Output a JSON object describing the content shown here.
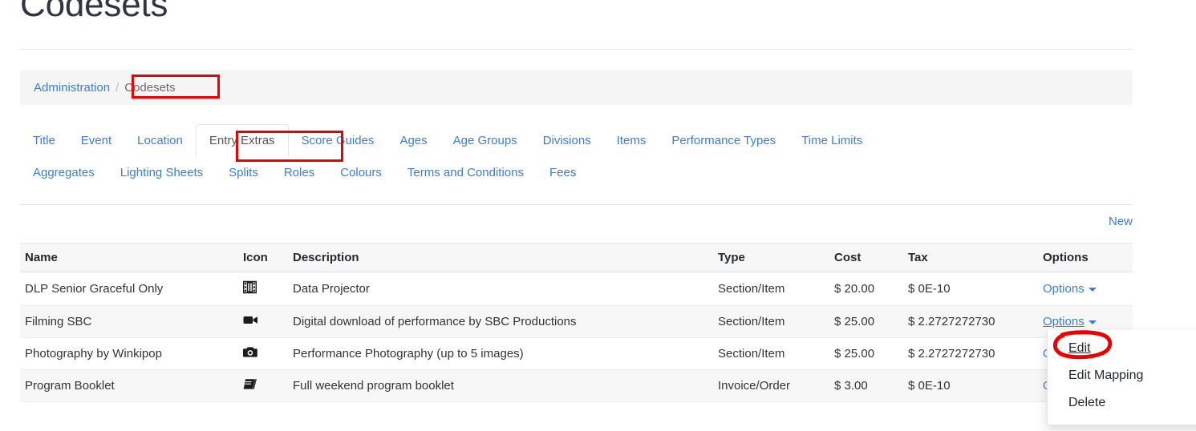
{
  "page": {
    "title": "Codesets"
  },
  "breadcrumb": {
    "parent": "Administration",
    "separator": "/",
    "current": "Codesets"
  },
  "tabs": {
    "row1": [
      {
        "label": "Title",
        "active": false
      },
      {
        "label": "Event",
        "active": false
      },
      {
        "label": "Location",
        "active": false
      },
      {
        "label": "Entry Extras",
        "active": true
      },
      {
        "label": "Score Guides",
        "active": false
      },
      {
        "label": "Ages",
        "active": false
      },
      {
        "label": "Age Groups",
        "active": false
      },
      {
        "label": "Divisions",
        "active": false
      },
      {
        "label": "Items",
        "active": false
      },
      {
        "label": "Performance Types",
        "active": false
      },
      {
        "label": "Time Limits",
        "active": false
      }
    ],
    "row2": [
      {
        "label": "Aggregates",
        "active": false
      },
      {
        "label": "Lighting Sheets",
        "active": false
      },
      {
        "label": "Splits",
        "active": false
      },
      {
        "label": "Roles",
        "active": false
      },
      {
        "label": "Colours",
        "active": false
      },
      {
        "label": "Terms and Conditions",
        "active": false
      },
      {
        "label": "Fees",
        "active": false
      }
    ]
  },
  "toolbar": {
    "new_label": "New"
  },
  "table": {
    "headers": [
      "Name",
      "Icon",
      "Description",
      "Type",
      "Cost",
      "Tax",
      "Options"
    ],
    "rows": [
      {
        "name": "DLP Senior Graceful Only",
        "icon": "film-icon",
        "description": "Data Projector",
        "type": "Section/Item",
        "cost": "$ 20.00",
        "tax": "$ 0E-10",
        "options_label": "Options"
      },
      {
        "name": "Filming SBC",
        "icon": "video-camera-icon",
        "description": "Digital download of performance by SBC Productions",
        "type": "Section/Item",
        "cost": "$ 25.00",
        "tax": "$ 2.2727272730",
        "options_label": "Options"
      },
      {
        "name": "Photography by Winkipop",
        "icon": "camera-icon",
        "description": "Performance Photography (up to 5 images)",
        "type": "Section/Item",
        "cost": "$ 25.00",
        "tax": "$ 2.2727272730",
        "options_label": "Options"
      },
      {
        "name": "Program Booklet",
        "icon": "book-icon",
        "description": "Full weekend program booklet",
        "type": "Invoice/Order",
        "cost": "$ 3.00",
        "tax": "$ 0E-10",
        "options_label": "Options"
      }
    ]
  },
  "dropdown": {
    "items": [
      {
        "label": "Edit",
        "hovered": true
      },
      {
        "label": "Edit Mapping",
        "hovered": false
      },
      {
        "label": "Delete",
        "hovered": false
      }
    ]
  },
  "annotations": {
    "color": "#ee0000",
    "marks": [
      {
        "kind": "box",
        "target": "breadcrumb-current-codesets"
      },
      {
        "kind": "box",
        "target": "tab-entry-extras"
      },
      {
        "kind": "circle",
        "target": "dropdown-item-edit"
      }
    ]
  },
  "colors": {
    "link": "#3b7dd8",
    "text": "#333333",
    "annotation": "#ee0000",
    "stripe": "#f7f7f7",
    "breadcrumb_bg": "#f5f5f5"
  }
}
